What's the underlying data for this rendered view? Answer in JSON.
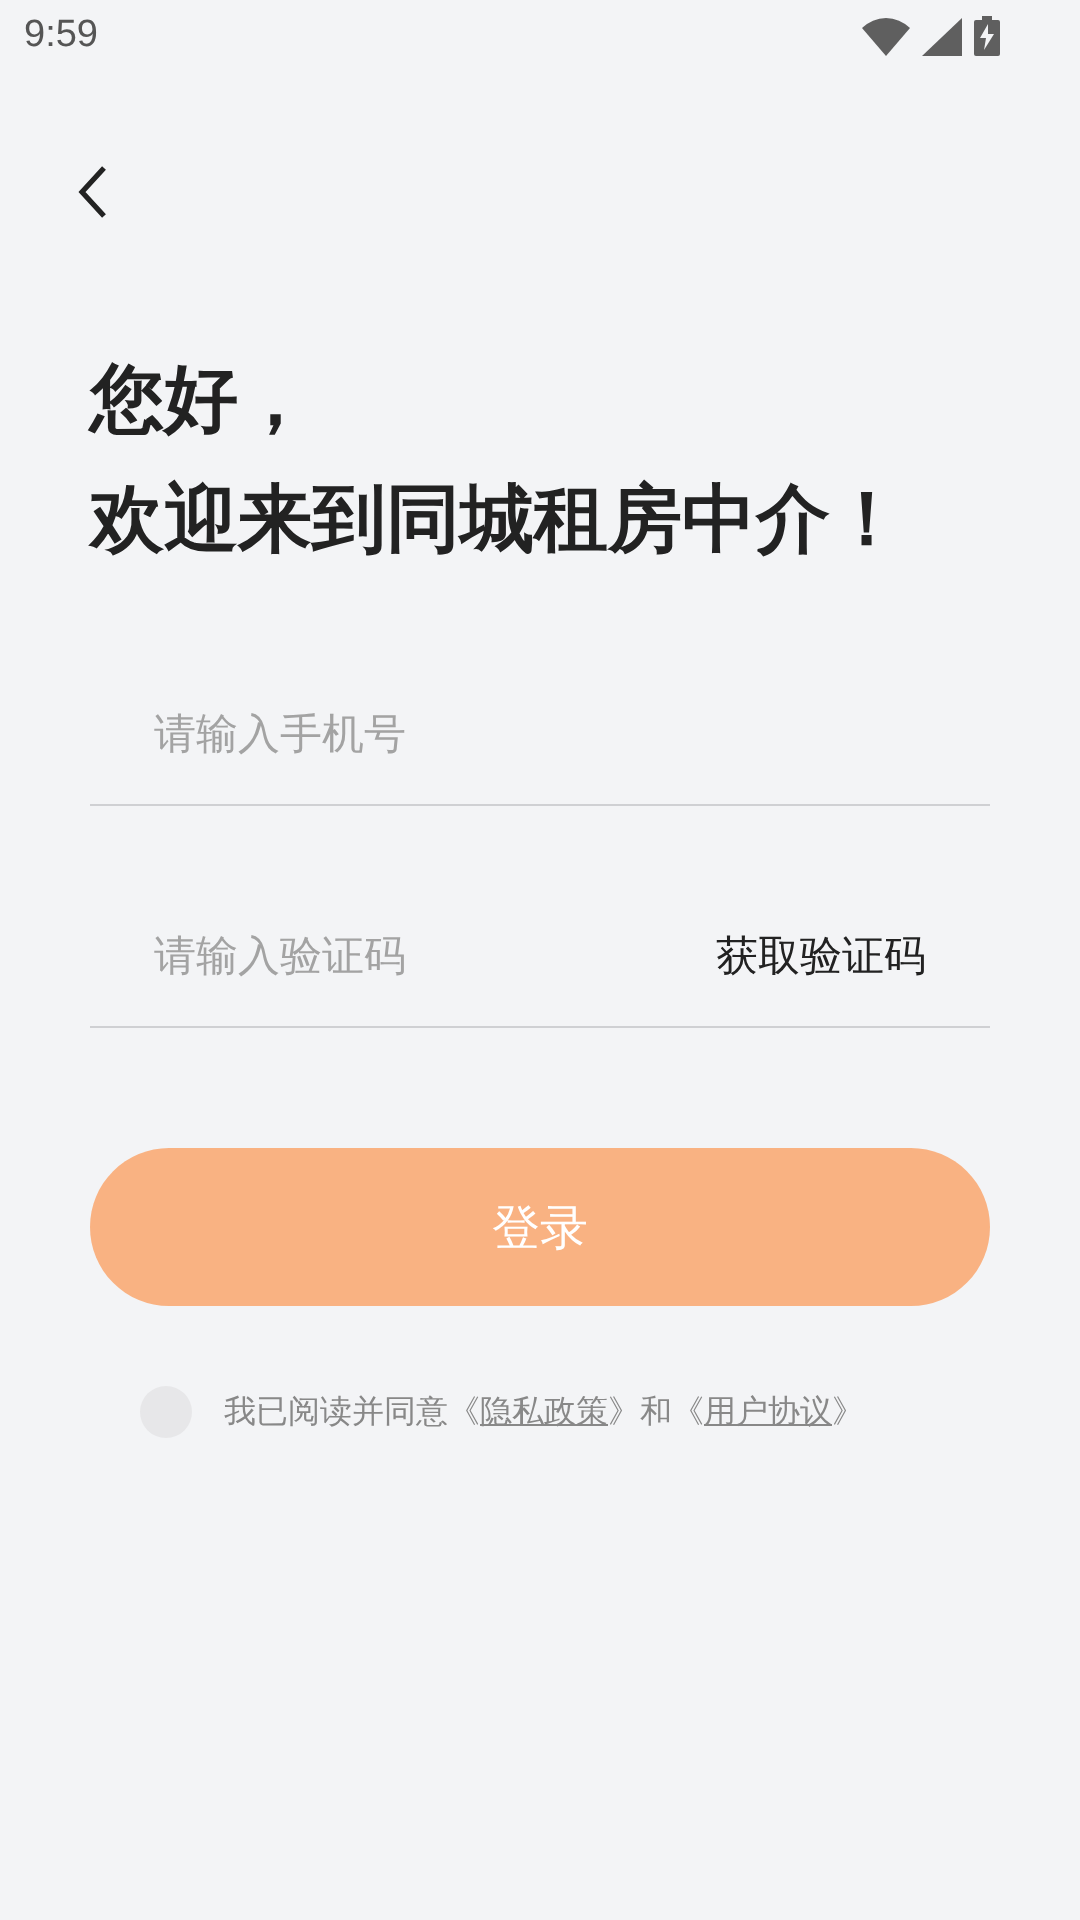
{
  "status_bar": {
    "time": "9:59"
  },
  "greeting": [
    "您好，",
    "欢迎来到同城租房中介！"
  ],
  "phone_field": {
    "placeholder": "请输入手机号"
  },
  "code_field": {
    "placeholder": "请输入验证码",
    "action": "获取验证码"
  },
  "login_button": {
    "label": "登录",
    "disabled": true
  },
  "agreement": {
    "checked": false,
    "parts": [
      {
        "kind": "text",
        "text": "我已阅读并同意《"
      },
      {
        "kind": "link",
        "text": "隐私政策"
      },
      {
        "kind": "text",
        "text": "》和《"
      },
      {
        "kind": "link",
        "text": "用户协议"
      },
      {
        "kind": "text",
        "text": "》"
      }
    ]
  }
}
